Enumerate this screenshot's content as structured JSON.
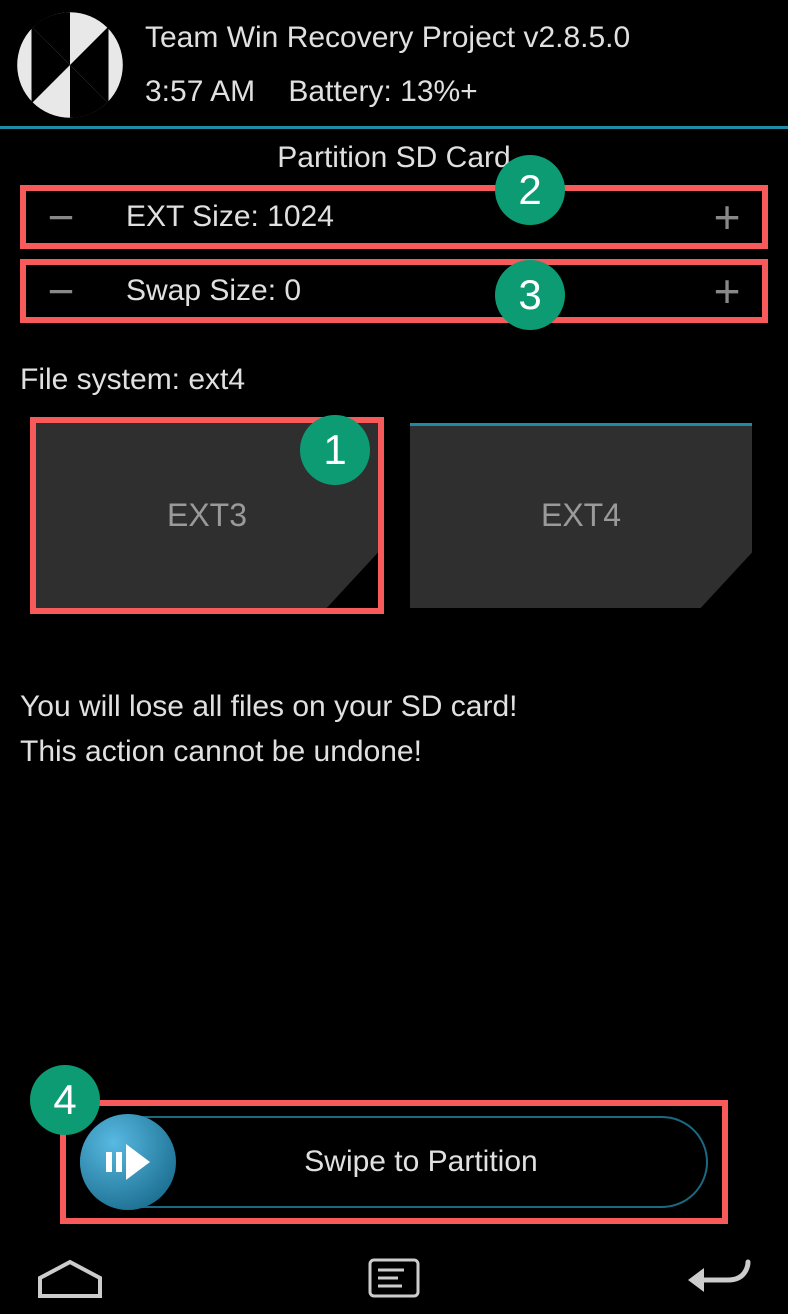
{
  "header": {
    "title": "Team Win Recovery Project  v2.8.5.0",
    "time": "3:57 AM",
    "battery_label": "Battery: 13%+"
  },
  "screen_title": "Partition SD Card",
  "steppers": {
    "ext": {
      "label": "EXT Size: 1024"
    },
    "swap": {
      "label": "Swap Size: 0"
    }
  },
  "file_system": {
    "label": "File system: ext4",
    "options": {
      "ext3": "EXT3",
      "ext4": "EXT4"
    }
  },
  "warning": {
    "line1": "You will lose all files on your SD card!",
    "line2": "This action cannot be undone!"
  },
  "swipe": {
    "label": "Swipe to Partition"
  },
  "annotations": {
    "b1": "1",
    "b2": "2",
    "b3": "3",
    "b4": "4"
  },
  "colors": {
    "accent": "#1e8aa6",
    "highlight": "#f75a5a",
    "badge": "#0d9b74"
  }
}
